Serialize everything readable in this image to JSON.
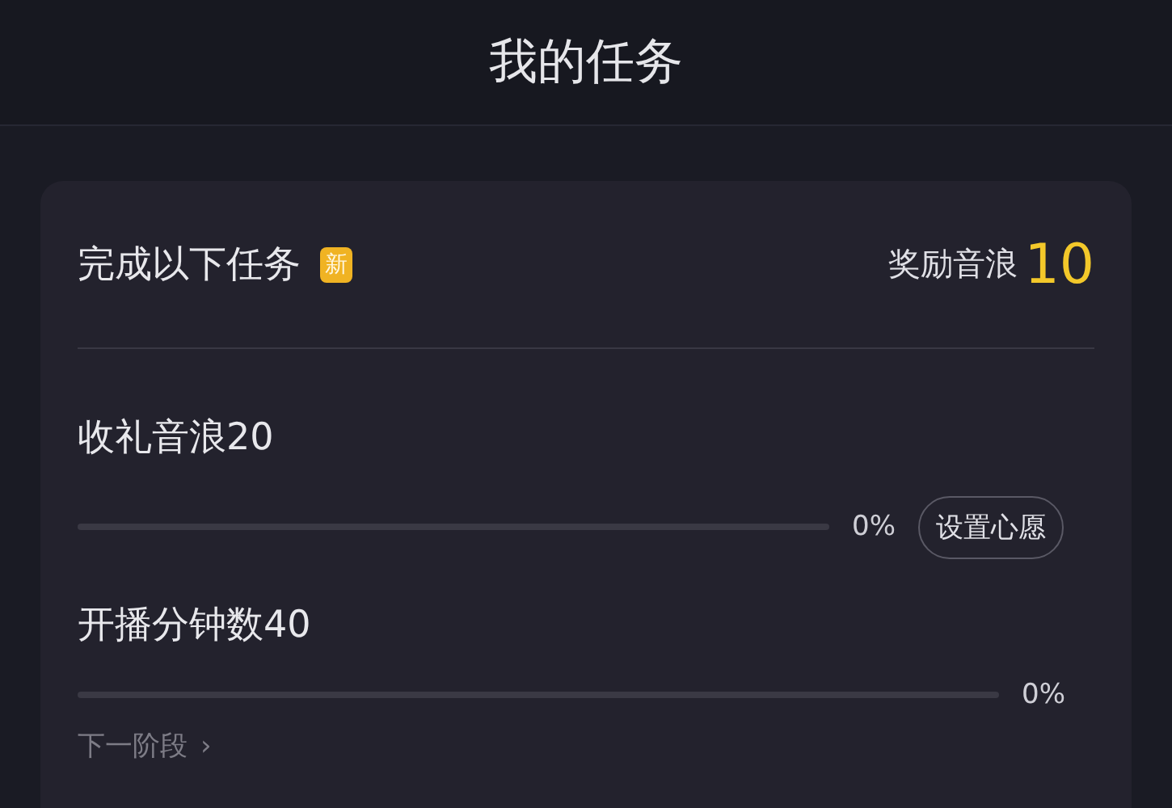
{
  "header": {
    "title": "我的任务"
  },
  "card": {
    "heading": "完成以下任务",
    "badge": "新",
    "reward_label": "奖励音浪",
    "reward_value": "10",
    "tasks": [
      {
        "kind": "wish",
        "name": "收礼音浪20",
        "level": 0,
        "reading": "0%",
        "button": "设置心愿"
      },
      {
        "kind": "plain",
        "name": "开播分钟数40",
        "level": 0,
        "reading": "0%"
      }
    ],
    "next_link": "下一阶段",
    "next_icon": "›"
  }
}
